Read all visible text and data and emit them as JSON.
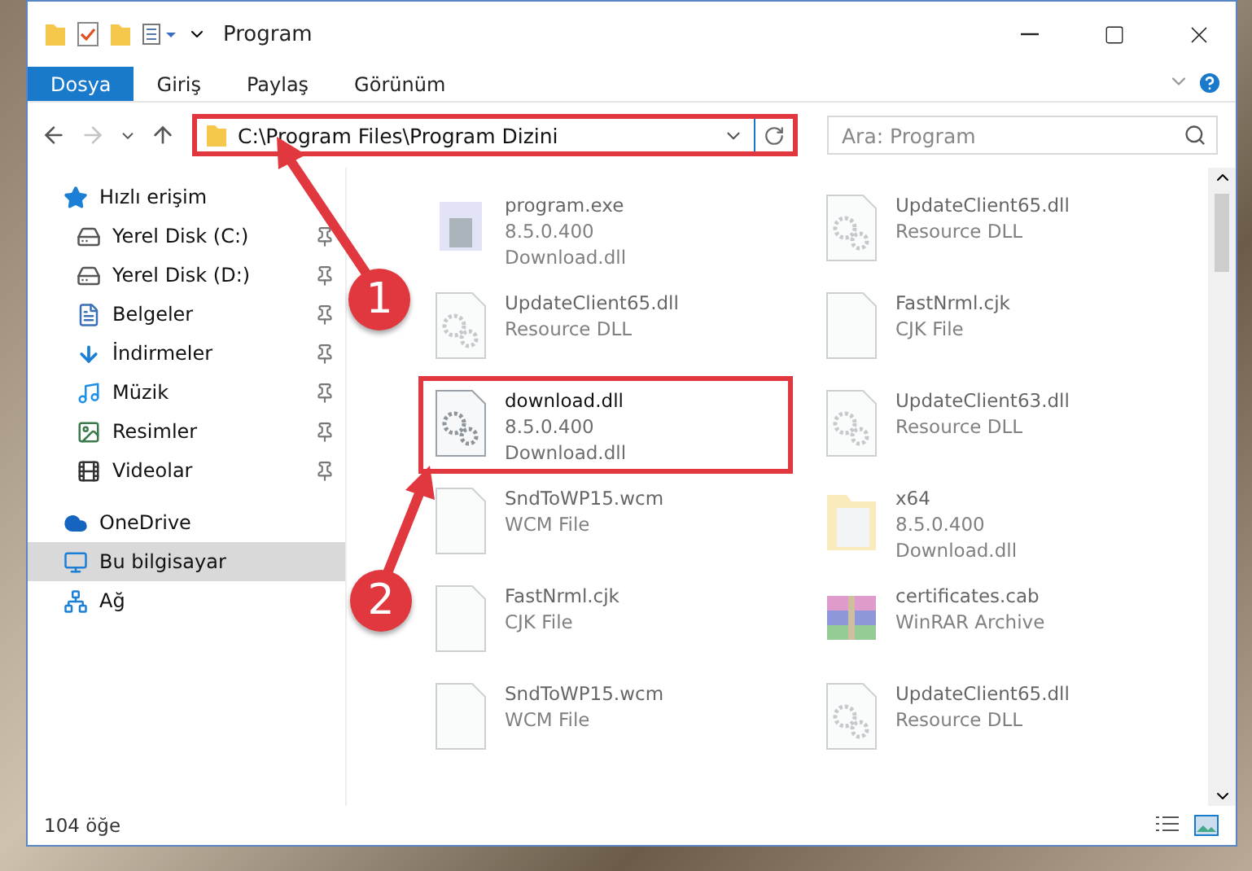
{
  "window": {
    "title": "Program"
  },
  "ribbon_tabs": [
    {
      "label": "Dosya",
      "selected": true
    },
    {
      "label": "Giriş",
      "selected": false
    },
    {
      "label": "Paylaş",
      "selected": false
    },
    {
      "label": "Görünüm",
      "selected": false
    }
  ],
  "address_bar": {
    "path": "C:\\Program Files\\Program Dizini",
    "highlighted": true
  },
  "search": {
    "placeholder": "Ara: Program"
  },
  "sidebar": {
    "items": [
      {
        "label": "Hızlı erişim",
        "kind": "star",
        "selected": false,
        "children": [
          {
            "label": "Yerel Disk (C:)",
            "kind": "drive",
            "selected": false,
            "pinned": true
          },
          {
            "label": "Yerel Disk (D:)",
            "kind": "drive",
            "selected": false,
            "pinned": true
          },
          {
            "label": "Belgeler",
            "kind": "document",
            "selected": false,
            "pinned": true
          },
          {
            "label": "İndirmeler",
            "kind": "download",
            "selected": false,
            "pinned": true
          },
          {
            "label": "Müzik",
            "kind": "music",
            "selected": false,
            "pinned": true
          },
          {
            "label": "Resimler",
            "kind": "picture",
            "selected": false,
            "pinned": true
          },
          {
            "label": "Videolar",
            "kind": "video",
            "selected": false,
            "pinned": true
          }
        ]
      },
      {
        "label": "OneDrive",
        "kind": "cloud",
        "selected": false
      },
      {
        "label": "Bu bilgisayar",
        "kind": "computer",
        "selected": true
      },
      {
        "label": "Ağ",
        "kind": "network",
        "selected": false
      }
    ]
  },
  "files": [
    {
      "name": "program.exe",
      "details": [
        "8.5.0.400",
        "Download.dll"
      ],
      "kind": "exe",
      "highlighted": false
    },
    {
      "name": "UpdateClient65.dll",
      "details": [
        "Resource DLL"
      ],
      "kind": "dll",
      "highlighted": false
    },
    {
      "name": "UpdateClient65.dll",
      "details": [
        "Resource DLL"
      ],
      "kind": "dll",
      "highlighted": false
    },
    {
      "name": "FastNrml.cjk",
      "details": [
        "CJK File"
      ],
      "kind": "file",
      "highlighted": false
    },
    {
      "name": "download.dll",
      "details": [
        "8.5.0.400",
        "Download.dll"
      ],
      "kind": "dll",
      "highlighted": true
    },
    {
      "name": "UpdateClient63.dll",
      "details": [
        "Resource DLL"
      ],
      "kind": "dll",
      "highlighted": false
    },
    {
      "name": "SndToWP15.wcm",
      "details": [
        "WCM File"
      ],
      "kind": "file",
      "highlighted": false
    },
    {
      "name": "x64",
      "details": [
        "8.5.0.400",
        "Download.dll"
      ],
      "kind": "folder",
      "highlighted": false
    },
    {
      "name": "FastNrml.cjk",
      "details": [
        "CJK File"
      ],
      "kind": "file",
      "highlighted": false
    },
    {
      "name": "certificates.cab",
      "details": [
        "WinRAR Archive"
      ],
      "kind": "archive",
      "highlighted": false
    },
    {
      "name": "SndToWP15.wcm",
      "details": [
        "WCM File"
      ],
      "kind": "file",
      "highlighted": false
    },
    {
      "name": "UpdateClient65.dll",
      "details": [
        "Resource DLL"
      ],
      "kind": "dll",
      "highlighted": false
    }
  ],
  "status_bar": {
    "count": "104 öğe"
  },
  "annotations": [
    {
      "label": "1"
    },
    {
      "label": "2"
    }
  ]
}
